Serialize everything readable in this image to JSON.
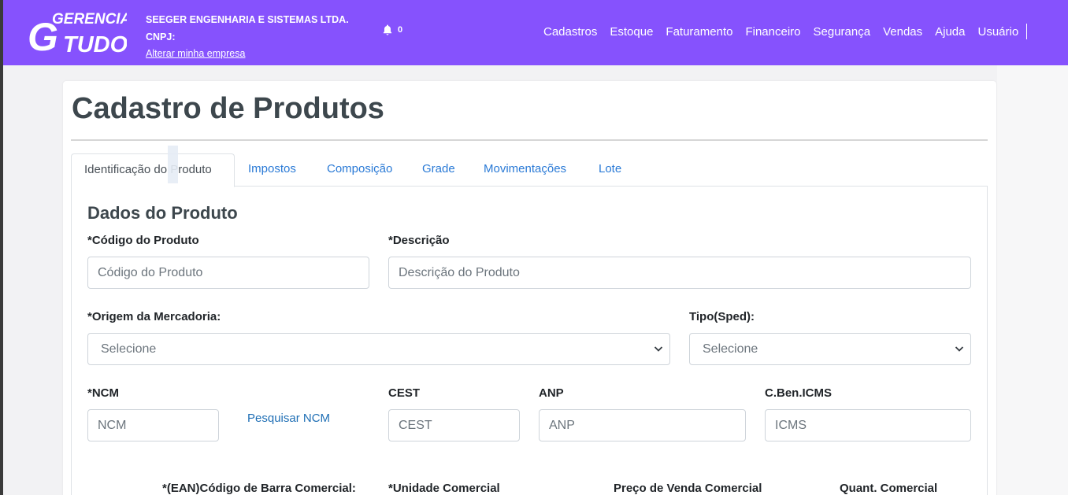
{
  "navbar": {
    "logo_top": "GERENCIA",
    "logo_bottom": "TUDO",
    "logo_big": "G",
    "company_name": "SEEGER ENGENHARIA E SISTEMAS LTDA.",
    "cnpj_label": "CNPJ:",
    "change_company_link": "Alterar minha empresa",
    "notifications_count": "0",
    "menu": [
      "Cadastros",
      "Estoque",
      "Faturamento",
      "Financeiro",
      "Segurança",
      "Vendas",
      "Ajuda",
      "Usuário"
    ]
  },
  "page": {
    "title": "Cadastro de Produtos",
    "tabs": [
      "Identificação do Produto",
      "Impostos",
      "Composição",
      "Grade",
      "Movimentações",
      "Lote"
    ],
    "active_tab": "Identificação do Produto"
  },
  "form": {
    "section_title": "Dados do Produto",
    "codigo": {
      "label": "*Código do Produto",
      "placeholder": "Código do Produto"
    },
    "descricao": {
      "label": "*Descrição",
      "placeholder": "Descrição do Produto"
    },
    "origem": {
      "label": "*Origem da Mercadoria:",
      "value": "Selecione"
    },
    "tipo": {
      "label": "Tipo(Sped):",
      "value": "Selecione"
    },
    "ncm": {
      "label": "*NCM",
      "placeholder": "NCM"
    },
    "pesquisar_ncm": "Pesquisar NCM",
    "cest": {
      "label": "CEST",
      "placeholder": "CEST"
    },
    "anp": {
      "label": "ANP",
      "placeholder": "ANP"
    },
    "cbenicms": {
      "label": "C.Ben.ICMS",
      "placeholder": "ICMS"
    },
    "ean_label": "*(EAN)Código de Barra Comercial:",
    "unidade_label": "*Unidade Comercial",
    "preco_label": "Preço de Venda Comercial",
    "quant_label": "Quant. Comercial"
  },
  "colors": {
    "navbar": "#8652fd",
    "link": "#2a7ad6",
    "title": "#3d474d"
  }
}
